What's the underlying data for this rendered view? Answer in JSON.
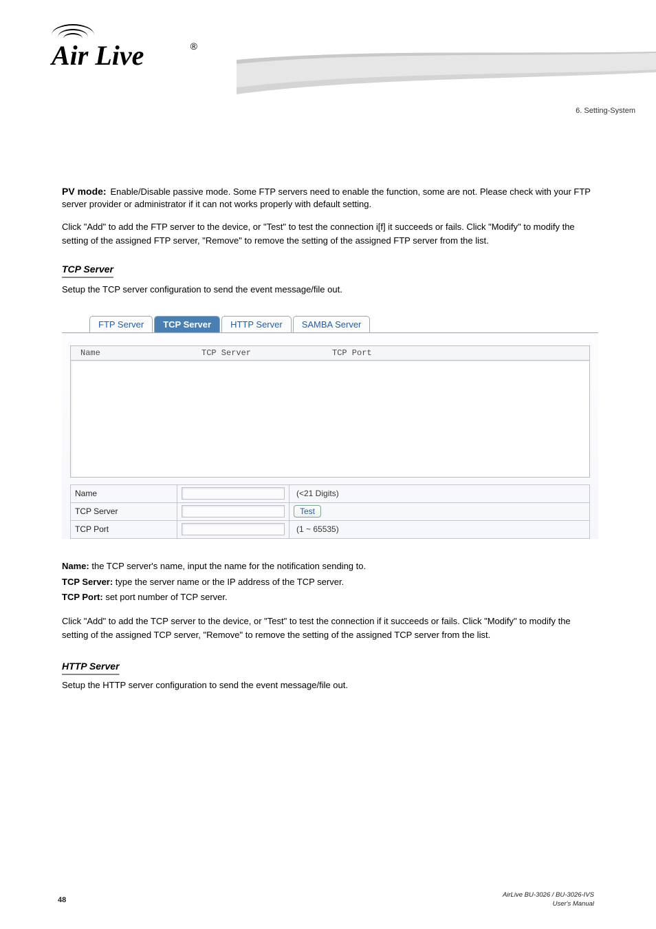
{
  "chapter": "6. Setting-System",
  "header": {
    "logo_text": "Air Live",
    "reg": "®"
  },
  "pv_mode": {
    "label": "PV mode:",
    "desc": "Enable/Disable passive mode. Some FTP servers need to enable the function, some are not. Please check with your FTP server provider or administrator if it can not works properly with default setting."
  },
  "click_add_ftp": "Click \"Add\" to add the FTP server to the device, or \"Test\" to test the connection i[f] it succeeds or fails. Click \"Modify\" to modify the setting of the assigned FTP server, \"Remove\" to remove the setting of the assigned FTP server from the list.",
  "tcp_section": {
    "title": "TCP Server",
    "setup": "Setup the TCP server configuration to send the event message/file out.",
    "tabs": {
      "ftp": "FTP Server",
      "tcp": "TCP Server",
      "http": "HTTP Server",
      "samba": "SAMBA Server"
    },
    "list_headers": {
      "name": "Name",
      "tcp_server": "TCP Server",
      "tcp_port": "TCP Port"
    },
    "form": {
      "name": {
        "label": "Name",
        "value": "",
        "hint": "(<21 Digits)"
      },
      "tcp_server": {
        "label": "TCP Server",
        "value": "",
        "test_btn": "Test"
      },
      "tcp_port": {
        "label": "TCP Port",
        "value": "",
        "hint": "(1 ~ 65535)"
      }
    },
    "fields": {
      "name": {
        "label": "Name:",
        "desc": " the TCP server's name, input the name for the notification sending to."
      },
      "tcp_server": {
        "label": "TCP Server:",
        "desc": " type the server name or the IP address of the TCP server."
      },
      "tcp_port": {
        "label": "TCP Port:",
        "desc": " set port number of TCP server."
      }
    },
    "click_add_tcp": "Click \"Add\" to add the TCP server to the device, or \"Test\" to test the connection if it succeeds or fails. Click \"Modify\" to modify the setting of the assigned TCP server, \"Remove\" to remove the setting of the assigned TCP server from the list."
  },
  "http_section": {
    "title": "HTTP Server",
    "setup": "Setup the HTTP server configuration to send the event message/file out."
  },
  "footer": {
    "page": "48",
    "model": "AirLive BU-3026 / BU-3026-IVS",
    "manual": "User's Manual"
  }
}
